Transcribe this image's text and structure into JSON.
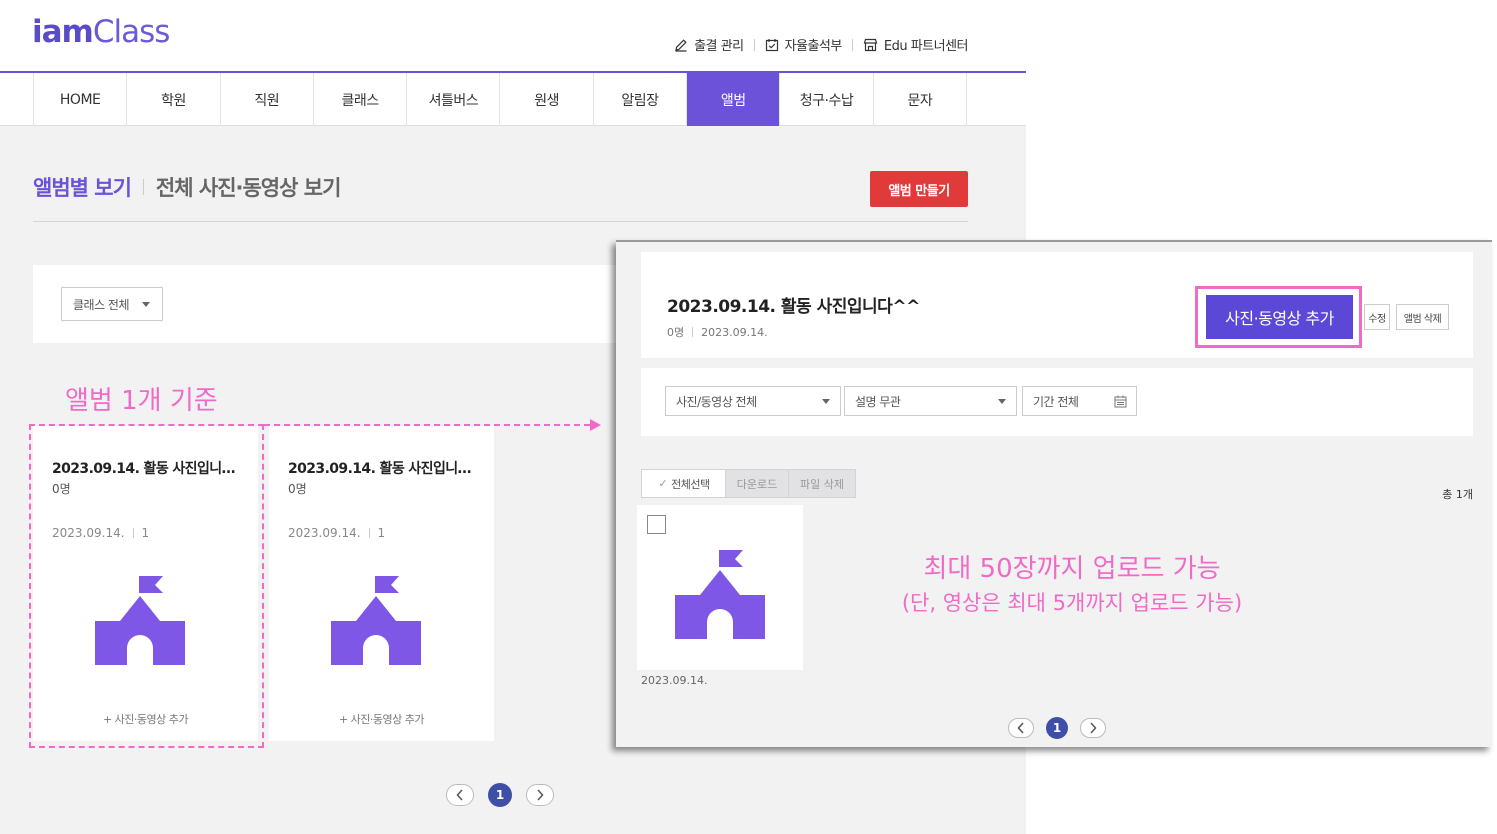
{
  "header": {
    "logo_bold": "iam",
    "logo_light": "Class",
    "util": [
      {
        "label": "출결 관리",
        "icon": "pencil-icon"
      },
      {
        "label": "자율출석부",
        "icon": "calendar-check-icon"
      },
      {
        "label": "Edu 파트너센터",
        "icon": "store-icon"
      }
    ]
  },
  "nav": {
    "items": [
      "HOME",
      "학원",
      "직원",
      "클래스",
      "셔틀버스",
      "원생",
      "알림장",
      "앨범",
      "청구·수납",
      "문자"
    ],
    "active": "앨범"
  },
  "main": {
    "view_album": "앨범별 보기",
    "view_all": "전체 사진·동영상 보기",
    "make_album": "앨범 만들기",
    "class_filter": "클래스 전체",
    "annotation": "앨범 1개 기준",
    "albums": [
      {
        "title": "2023.09.14. 활동 사진입니…",
        "count": "0명",
        "date": "2023.09.14.",
        "num": "1",
        "add": "+ 사진·동영상 추가"
      },
      {
        "title": "2023.09.14. 활동 사진입니…",
        "count": "0명",
        "date": "2023.09.14.",
        "num": "1",
        "add": "+ 사진·동영상 추가"
      }
    ],
    "page": "1"
  },
  "detail": {
    "title": "2023.09.14. 활동 사진입니다^^",
    "count": "0명",
    "date": "2023.09.14.",
    "add_media": "사진·동영상 추가",
    "edit": "수정",
    "delete_album": "앨범 삭제",
    "filter_type": "사진/동영상 전체",
    "filter_desc": "설명 무관",
    "filter_period": "기간 전체",
    "select_all": "전체선택",
    "download": "다운로드",
    "delete_file": "파일 삭제",
    "total": "총 1개",
    "photo_date": "2023.09.14.",
    "annotation_line1": "최대 50장까지 업로드 가능",
    "annotation_line2": "(단, 영상은 최대 5개까지 업로드 가능)",
    "page": "1"
  },
  "colors": {
    "brand": "#6b52d9",
    "accent_red": "#e03a3a",
    "annotation_pink": "#f06bc6",
    "pager_active": "#3e4fa8"
  }
}
